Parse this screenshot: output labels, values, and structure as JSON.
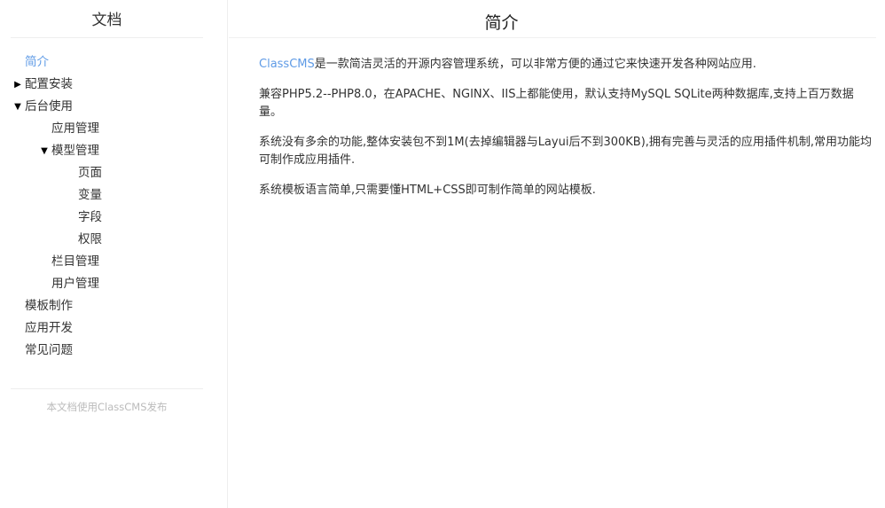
{
  "sidebar": {
    "title": "文档",
    "items": [
      {
        "label": "简介",
        "arrow": ""
      },
      {
        "label": "配置安装",
        "arrow": "▶"
      },
      {
        "label": "后台使用",
        "arrow": "▼"
      },
      {
        "label": "应用管理",
        "arrow": ""
      },
      {
        "label": "模型管理",
        "arrow": "▼"
      },
      {
        "label": "页面",
        "arrow": ""
      },
      {
        "label": "变量",
        "arrow": ""
      },
      {
        "label": "字段",
        "arrow": ""
      },
      {
        "label": "权限",
        "arrow": ""
      },
      {
        "label": "栏目管理",
        "arrow": ""
      },
      {
        "label": "用户管理",
        "arrow": ""
      },
      {
        "label": "模板制作",
        "arrow": ""
      },
      {
        "label": "应用开发",
        "arrow": ""
      },
      {
        "label": "常见问题",
        "arrow": ""
      }
    ],
    "footer": "本文档使用ClassCMS发布"
  },
  "main": {
    "title": "简介",
    "paragraphs": {
      "p1_link": "ClassCMS",
      "p1_rest": "是一款简洁灵活的开源内容管理系统，可以非常方便的通过它来快速开发各种网站应用.",
      "p2": "兼容PHP5.2--PHP8.0，在APACHE、NGINX、IIS上都能使用，默认支持MySQL SQLite两种数据库,支持上百万数据量。",
      "p3": "系统没有多余的功能,整体安装包不到1M(去掉编辑器与Layui后不到300KB),拥有完善与灵活的应用插件机制,常用功能均可制作成应用插件.",
      "p4": "系统模板语言简单,只需要懂HTML+CSS即可制作简单的网站模板."
    }
  },
  "colors": {
    "accent": "#5f9be6",
    "divider": "#eeeeee",
    "footer_text": "#bbbbbb"
  }
}
